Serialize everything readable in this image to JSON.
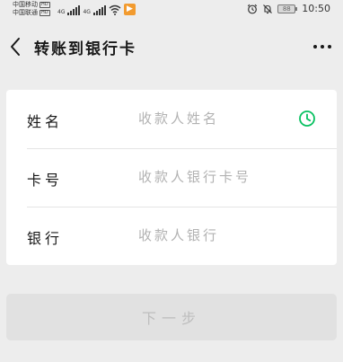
{
  "status_bar": {
    "carrier_1": "中国移动",
    "carrier_2": "中国联通",
    "hd_label": "HD",
    "network_1": "4G",
    "network_2": "4G",
    "battery_level": "88",
    "time": "10:50",
    "icons": [
      "signal-icon",
      "wifi-icon",
      "notification-badge-icon",
      "alarm-icon",
      "mute-icon",
      "battery-icon"
    ]
  },
  "nav": {
    "title": "转账到银行卡",
    "back_icon": "chevron-left-icon",
    "more_icon": "more-dots-icon"
  },
  "form": {
    "fields": [
      {
        "label": "姓名",
        "placeholder": "收款人姓名",
        "value": ""
      },
      {
        "label": "卡号",
        "placeholder": "收款人银行卡号",
        "value": ""
      },
      {
        "label": "银行",
        "placeholder": "收款人银行",
        "value": ""
      }
    ],
    "history_icon": "clock-icon"
  },
  "next_button": {
    "label": "下一步",
    "enabled": false
  },
  "colors": {
    "background": "#ededed",
    "card": "#ffffff",
    "accent_green": "#07c160",
    "disabled_button": "#e1e1e1",
    "placeholder": "#b2b2b2"
  }
}
